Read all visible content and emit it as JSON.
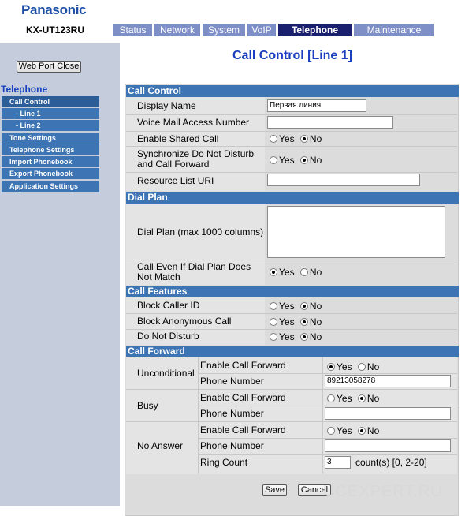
{
  "header": {
    "brand": "Panasonic",
    "model": "KX-UT123RU",
    "tabs": [
      {
        "label": "Status"
      },
      {
        "label": "Network"
      },
      {
        "label": "System"
      },
      {
        "label": "VoIP"
      },
      {
        "label": "Telephone"
      },
      {
        "label": "Maintenance"
      }
    ],
    "active_tab": "Telephone"
  },
  "sidebar": {
    "web_port_close": "Web Port Close",
    "title": "Telephone",
    "items": [
      {
        "label": "Call Control"
      },
      {
        "label": "- Line 1"
      },
      {
        "label": "- Line 2"
      },
      {
        "label": "Tone Settings"
      },
      {
        "label": "Telephone Settings"
      },
      {
        "label": "Import Phonebook"
      },
      {
        "label": "Export Phonebook"
      },
      {
        "label": "Application Settings"
      }
    ]
  },
  "page": {
    "title": "Call Control [Line 1]"
  },
  "sections": {
    "call_control": {
      "title": "Call Control",
      "display_name_label": "Display Name",
      "display_name_value": "Первая линия",
      "voicemail_label": "Voice Mail Access Number",
      "voicemail_value": "",
      "shared_label": "Enable Shared Call",
      "sync_label_1": "Synchronize Do Not Disturb",
      "sync_label_2": "and Call Forward",
      "uri_label": "Resource List URI",
      "uri_value": ""
    },
    "dial_plan": {
      "title": "Dial Plan",
      "dial_plan_label": "Dial Plan (max 1000 columns)",
      "dial_plan_value": "",
      "call_even_label_1": "Call Even If Dial Plan Does",
      "call_even_label_2": "Not Match"
    },
    "call_features": {
      "title": "Call Features",
      "block_caller_label": "Block Caller ID",
      "block_anon_label": "Block Anonymous Call",
      "dnd_label": "Do Not Disturb"
    },
    "call_forward": {
      "title": "Call Forward",
      "unconditional": "Unconditional",
      "busy": "Busy",
      "no_answer": "No Answer",
      "enable_label": "Enable Call Forward",
      "phone_label": "Phone Number",
      "uncond_phone": "89213058278",
      "busy_phone": "",
      "noans_phone": "",
      "ring_count_label": "Ring Count",
      "ring_count_value": "3",
      "ring_count_hint": "count(s) [0, 2-20]"
    }
  },
  "radio": {
    "yes": "Yes",
    "no": "No"
  },
  "buttons": {
    "save": "Save",
    "cancel": "Cancel"
  },
  "watermark": "UCEXPERT.RU"
}
